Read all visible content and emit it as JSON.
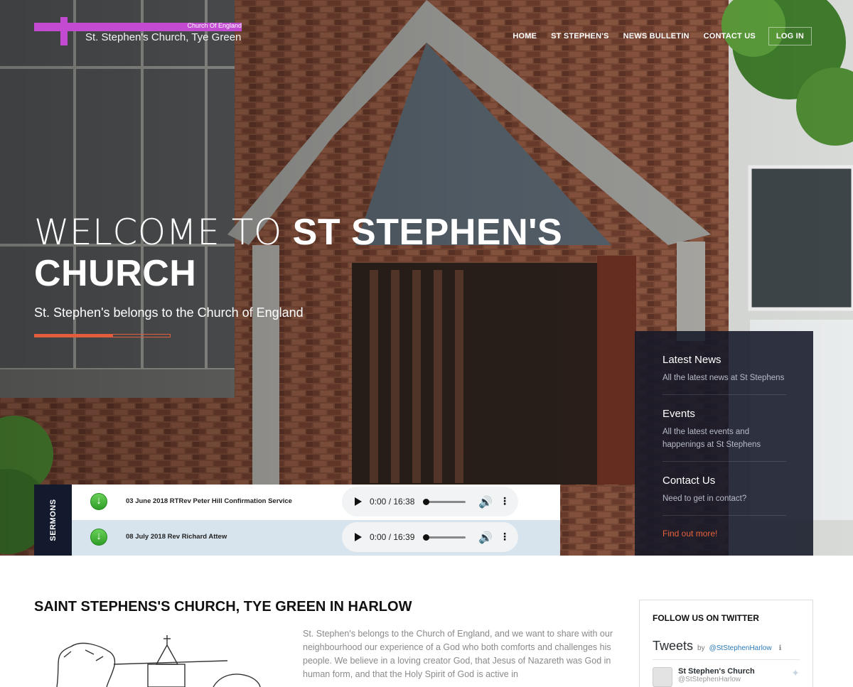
{
  "header": {
    "logo_top": "Church Of England",
    "logo_name": "St. Stephen's Church, Tye Green",
    "nav": [
      "HOME",
      "ST STEPHEN'S",
      "NEWS BULLETIN",
      "CONTACT US",
      "LOG IN"
    ]
  },
  "hero": {
    "welcome_thin": "WELCOME TO",
    "welcome_bold_1": "ST STEPHEN'S",
    "welcome_bold_2": "CHURCH",
    "tagline": "St. Stephen's belongs to the Church of England",
    "divider_progress": 0.58
  },
  "side_panel": {
    "items": [
      {
        "title": "Latest News",
        "desc": "All the latest news at St Stephens"
      },
      {
        "title": "Events",
        "desc": "All the latest events and happenings at St Stephens"
      },
      {
        "title": "Contact Us",
        "desc": "Need to get in contact?"
      }
    ],
    "link": "Find out more!"
  },
  "sermons": {
    "tab_label": "SERMONS",
    "items": [
      {
        "title": "03 June 2018 RTRev Peter Hill Confirmation Service",
        "time": "0:00 / 16:38"
      },
      {
        "title": "08 July 2018 Rev Richard Attew",
        "time": "0:00 / 16:39"
      }
    ]
  },
  "main": {
    "title": "SAINT STEPHENS'S CHURCH, TYE GREEN IN HARLOW",
    "intro": "St. Stephen's belongs to the Church of England, and we want to share with our neighbourhood our experience of a God who both comforts and challenges his people. We believe in a loving creator God, that Jesus of Nazareth was God in human form, and that the Holy Spirit of God is active in"
  },
  "twitter": {
    "heading": "FOLLOW US ON TWITTER",
    "tweets_label": "Tweets",
    "by_label": "by",
    "handle": "@StStephenHarlow",
    "user_name": "St Stephen's Church",
    "user_handle": "@StStephenHarlow"
  },
  "colors": {
    "accent": "#e8623d",
    "logo_purple": "#c24bd1",
    "panel_bg": "#141a2e"
  }
}
